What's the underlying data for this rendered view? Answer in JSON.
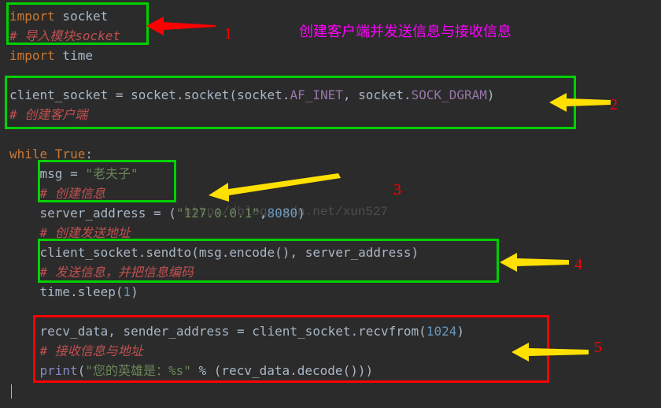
{
  "title": "创建客户端并发送信息与接收信息",
  "labels": {
    "n1": "1",
    "n2": "2",
    "n3": "3",
    "n4": "4",
    "n5": "5"
  },
  "watermark": "http://blog.csdn.net/xun527",
  "code": {
    "l1_kw": "import",
    "l1_mod": " socket",
    "l2": "# 导入模块socket",
    "l3_kw": "import",
    "l3_mod": " time",
    "l5a": "client_socket ",
    "l5b": "=",
    "l5c": " socket",
    "l5d": ".",
    "l5e": "socket",
    "l5f": "(",
    "l5g": "socket",
    "l5h": ".",
    "l5i": "AF_INET",
    "l5j": ", ",
    "l5k": "socket",
    "l5l": ".",
    "l5m": "SOCK_DGRAM",
    "l5n": ")",
    "l6": "# 创建客户端",
    "l8a": "while ",
    "l8b": "True",
    "l8c": ":",
    "l9a": "    msg ",
    "l9b": "= ",
    "l9c": "\"老夫子\"",
    "l10": "    # 创建信息",
    "l11a": "    server_address ",
    "l11b": "= ",
    "l11c": "(",
    "l11d": "\"127.0.0.1\"",
    "l11e": ",",
    "l11f": "8080",
    "l11g": ")",
    "l12": "    # 创建发送地址",
    "l13a": "    client_socket.",
    "l13b": "sendto",
    "l13c": "(msg.",
    "l13d": "encode",
    "l13e": "(), server_address",
    "l13f": ")",
    "l14": "    # 发送信息，并把信息编码",
    "l15a": "    time.",
    "l15b": "sleep",
    "l15c": "(",
    "l15d": "1",
    "l15e": ")",
    "l17a": "    recv_data, sender_address ",
    "l17b": "= ",
    "l17c": "client_socket.",
    "l17d": "recvfrom",
    "l17e": "(",
    "l17f": "1024",
    "l17g": ")",
    "l18": "    # 接收信息与地址",
    "l19a": "    ",
    "l19b": "print",
    "l19c": "(",
    "l19d": "\"您的英雄是：%s\"",
    "l19e": " % ",
    "l19f": "(recv_data.",
    "l19g": "decode",
    "l19h": "()))"
  }
}
